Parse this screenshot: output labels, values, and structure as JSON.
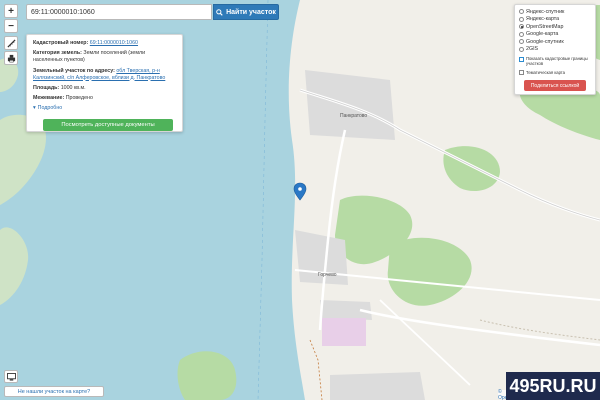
{
  "search": {
    "value": "69:11:0000010:1060",
    "button_label": "Найти участок"
  },
  "zoom": {
    "in_label": "+",
    "out_label": "−"
  },
  "info": {
    "cadastral_label": "Кадастровый номер:",
    "cadastral_value": "69:11:0000010:1060",
    "category_label": "Категория земель:",
    "category_value": "Земли поселений (земли населенных пунктов)",
    "address_label": "Земельный участок по адресу:",
    "address_value": "обл Тверская, р-н Калязинский, с/п Алферовское, вблизи д. Панкратово",
    "area_label": "Площадь:",
    "area_value": "1000 кв.м.",
    "survey_label": "Межевание:",
    "survey_value": "Проведено",
    "more_label": "Подробно",
    "docs_button": "Посмотреть доступные документы"
  },
  "layers": {
    "options": [
      {
        "label": "Яндекс-спутник",
        "selected": false
      },
      {
        "label": "Яндекс-карта",
        "selected": false
      },
      {
        "label": "OpenStreetMap",
        "selected": true
      },
      {
        "label": "Google-карта",
        "selected": false
      },
      {
        "label": "Google-спутник",
        "selected": false
      },
      {
        "label": "2GIS",
        "selected": false
      }
    ],
    "check_borders": "Показать кадастровые границы участков",
    "check_thematic": "Тематическая карта",
    "share_button": "Поделиться ссылкой"
  },
  "map": {
    "village_top": "Панкратово",
    "village_bottom": "Горчево"
  },
  "footer": {
    "not_found": "Не нашли участок на карте?",
    "attribution": "© OpenStreet"
  },
  "watermark": "495RU.RU",
  "colors": {
    "water": "#a9d3df",
    "land": "#f1efe9",
    "forest": "#b6dba4",
    "residential": "#dcdcdc",
    "search_button": "#2f7ab8",
    "docs_button": "#4fb35a",
    "share_button": "#d9534f",
    "marker": "#2a78c6"
  }
}
